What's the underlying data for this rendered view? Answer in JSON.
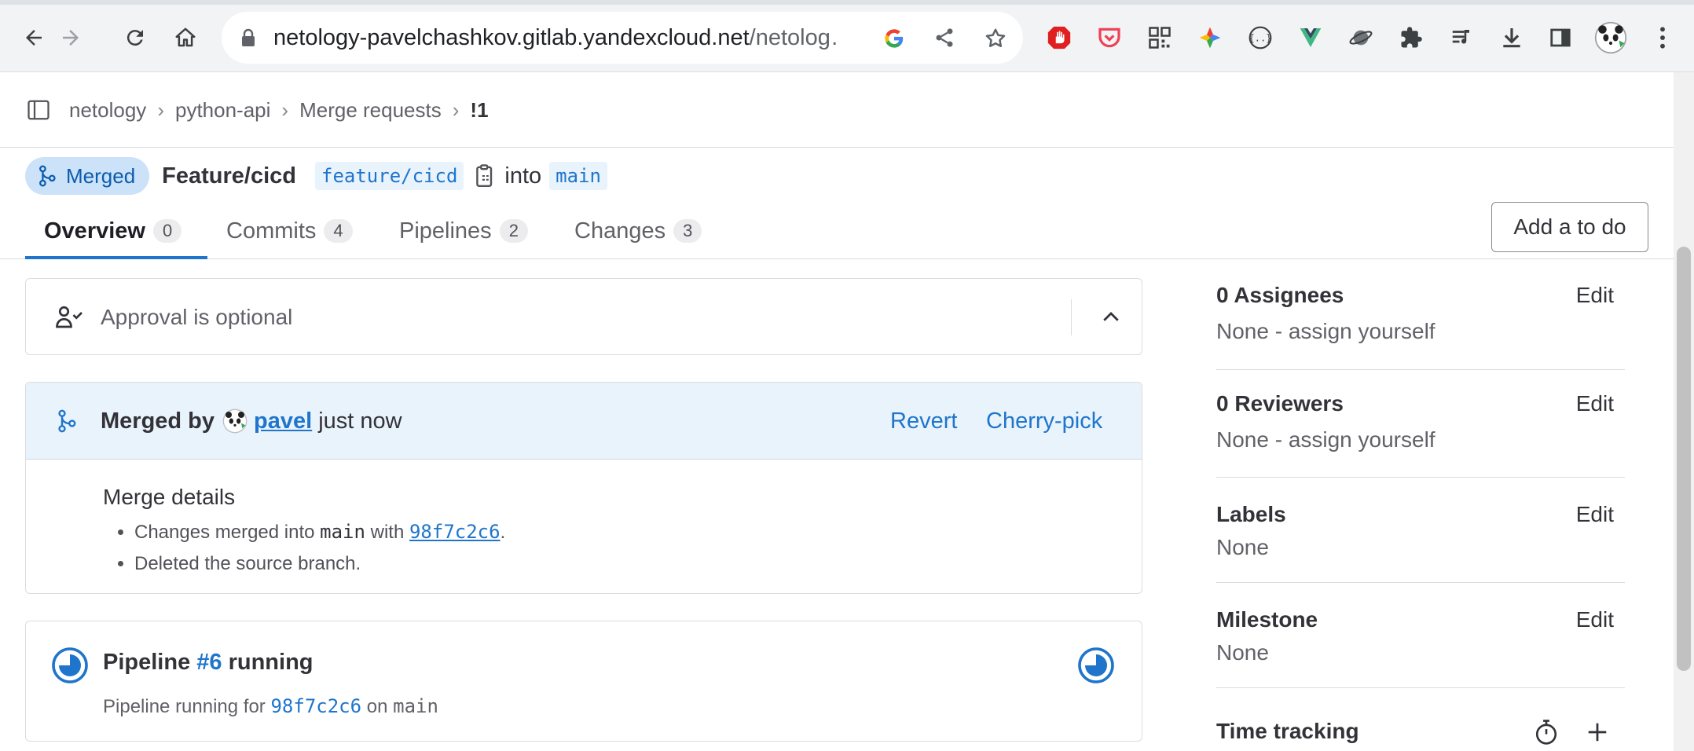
{
  "browser": {
    "url_host": "netology-pavelchashkov.gitlab.yandexcloud.net",
    "url_path": "/netolog…"
  },
  "breadcrumb": {
    "items": [
      "netology",
      "python-api",
      "Merge requests",
      "!1"
    ]
  },
  "mr": {
    "status": "Merged",
    "title": "Feature/cicd",
    "source_branch": "feature/cicd",
    "into_label": "into",
    "target_branch": "main"
  },
  "tabs": [
    {
      "label": "Overview",
      "count": "0"
    },
    {
      "label": "Commits",
      "count": "4"
    },
    {
      "label": "Pipelines",
      "count": "2"
    },
    {
      "label": "Changes",
      "count": "3"
    }
  ],
  "todo_button": "Add a to do",
  "approval": {
    "label": "Approval is optional"
  },
  "merged": {
    "prefix": "Merged by",
    "user": "pavel",
    "time": "just now",
    "revert": "Revert",
    "cherry_pick": "Cherry-pick",
    "details_title": "Merge details",
    "line1_a": "Changes merged into",
    "line1_branch": "main",
    "line1_b": "with",
    "line1_sha": "98f7c2c6",
    "line1_end": ".",
    "line2": "Deleted the source branch."
  },
  "pipeline": {
    "word": "Pipeline",
    "number": "#6",
    "state": "running",
    "sub_a": "Pipeline running for",
    "sub_sha": "98f7c2c6",
    "sub_on": "on",
    "sub_branch": "main"
  },
  "sidebar": {
    "assignees": {
      "title": "0 Assignees",
      "value": "None - assign yourself",
      "edit": "Edit"
    },
    "reviewers": {
      "title": "0 Reviewers",
      "value": "None - assign yourself",
      "edit": "Edit"
    },
    "labels": {
      "title": "Labels",
      "value": "None",
      "edit": "Edit"
    },
    "milestone": {
      "title": "Milestone",
      "value": "None",
      "edit": "Edit"
    },
    "time_tracking": {
      "title": "Time tracking"
    }
  },
  "colors": {
    "accent": "#1f75cb",
    "merged_bg": "#cbe2f9",
    "info_bg": "#e9f3fc"
  },
  "icons": [
    "back-icon",
    "forward-icon",
    "reload-icon",
    "home-icon",
    "lock-icon",
    "google-icon",
    "share-icon",
    "star-icon",
    "extension-icon",
    "download-icon",
    "sidebar-icon",
    "menu-icon",
    "merge-icon",
    "copy-icon",
    "approval-icon",
    "chevron-up-icon",
    "pipeline-running-icon",
    "stopwatch-icon",
    "plus-icon"
  ]
}
